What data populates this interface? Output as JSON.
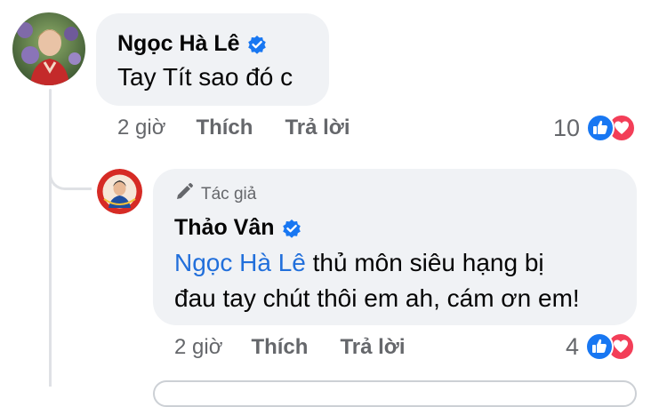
{
  "comments": [
    {
      "author": "Ngọc Hà Lê",
      "text": "Tay Tít sao đó c",
      "time": "2 giờ",
      "like_label": "Thích",
      "reply_label": "Trả lời",
      "reaction_count": "10",
      "verified": true
    }
  ],
  "reply": {
    "author_badge": "Tác giả",
    "author": "Thảo Vân",
    "mention": "Ngọc Hà Lê",
    "text_line1": " thủ môn siêu hạng bị",
    "text_line2": "đau tay chút thôi em ah, cám ơn em!",
    "time": "2 giờ",
    "like_label": "Thích",
    "reply_label": "Trả lời",
    "reaction_count": "4",
    "verified": true
  },
  "colors": {
    "verified_blue": "#1877f2",
    "like_blue": "#1877f2",
    "love_red": "#f33e58",
    "mention_blue": "#216fdb",
    "bubble_bg": "#f0f2f5",
    "meta_gray": "#65676b"
  },
  "icons": [
    "verified-badge-icon",
    "like-reaction-icon",
    "love-reaction-icon",
    "pencil-icon"
  ]
}
